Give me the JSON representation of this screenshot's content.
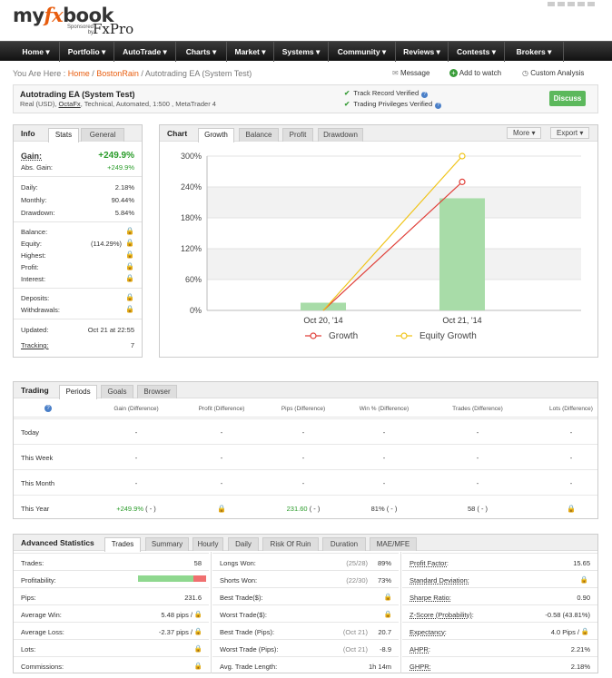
{
  "brand": {
    "logo_left": "my",
    "logo_fx": "fx",
    "logo_right": "book",
    "sponsored": "Sponsored",
    "by": "by",
    "sponsor": "FxPro"
  },
  "nav": [
    "Home ▾",
    "Portfolio ▾",
    "AutoTrade ▾",
    "Charts ▾",
    "Market ▾",
    "Systems ▾",
    "Community ▾",
    "Reviews ▾",
    "Contests ▾",
    "Brokers ▾"
  ],
  "breadcrumb": {
    "prefix": "You Are Here :",
    "home": "Home",
    "sep1": "/",
    "user": "BostonRain",
    "sep2": "/",
    "page": "Autotrading EA (System Test)"
  },
  "actions": {
    "message": "Message",
    "watch": "Add to watch",
    "custom": "Custom Analysis"
  },
  "system": {
    "title": "Autotrading EA (System Test)",
    "sub_pre": "Real (USD), ",
    "broker": "OctaFx",
    "sub_post": ", Technical, Automated, 1:500 , MetaTrader 4",
    "verified1": "Track Record Verified",
    "verified2": "Trading Privileges Verified",
    "discuss": "Discuss"
  },
  "info": {
    "title": "Info",
    "tabs": [
      "Stats",
      "General"
    ],
    "gain_label": "Gain:",
    "gain_value": "+249.9%",
    "abs_label": "Abs. Gain:",
    "abs_value": "+249.9%",
    "daily_label": "Daily:",
    "daily_value": "2.18%",
    "monthly_label": "Monthly:",
    "monthly_value": "90.44%",
    "drawdown_label": "Drawdown:",
    "drawdown_value": "5.84%",
    "balance_label": "Balance:",
    "equity_label": "Equity:",
    "equity_value": "(114.29%)",
    "highest_label": "Highest:",
    "profit_label": "Profit:",
    "interest_label": "Interest:",
    "deposits_label": "Deposits:",
    "withdrawals_label": "Withdrawals:",
    "updated_label": "Updated:",
    "updated_value": "Oct 21 at 22:55",
    "tracking_label": "Tracking:",
    "tracking_value": "7"
  },
  "chartpanel": {
    "title": "Chart",
    "tabs": [
      "Growth",
      "Balance",
      "Profit",
      "Drawdown"
    ],
    "more": "More ▾",
    "export": "Export ▾"
  },
  "chart_data": {
    "type": "line",
    "categories": [
      "Oct 20, '14",
      "Oct 21, '14"
    ],
    "series": [
      {
        "name": "Growth",
        "values": [
          0,
          249.9
        ],
        "color": "#e0403a"
      },
      {
        "name": "Equity Growth",
        "values": [
          0,
          300
        ],
        "color": "#f0c419"
      }
    ],
    "bars": [
      15,
      218
    ],
    "bar_color": "#a8dca8",
    "yticks": [
      "300%",
      "240%",
      "180%",
      "120%",
      "60%",
      "0%"
    ],
    "ylim": [
      0,
      300
    ]
  },
  "trading": {
    "title": "Trading",
    "tabs": [
      "Periods",
      "Goals",
      "Browser"
    ],
    "headers": [
      "Gain (Difference)",
      "Profit (Difference)",
      "Pips (Difference)",
      "Win % (Difference)",
      "Trades (Difference)",
      "Lots (Difference)"
    ],
    "rows": [
      {
        "label": "Today",
        "cells": [
          "-",
          "-",
          "-",
          "-",
          "-",
          "-"
        ]
      },
      {
        "label": "This Week",
        "cells": [
          "-",
          "-",
          "-",
          "-",
          "-",
          "-"
        ]
      },
      {
        "label": "This Month",
        "cells": [
          "-",
          "-",
          "-",
          "-",
          "-",
          "-"
        ]
      },
      {
        "label": "This Year",
        "cells": [
          "+249.9%",
          "",
          "231.60",
          "81%",
          "58",
          ""
        ],
        "diffs": [
          "( - )",
          "",
          "( - )",
          "( - )",
          "( - )",
          ""
        ]
      }
    ]
  },
  "advanced": {
    "title": "Advanced Statistics",
    "tabs": [
      "Trades",
      "Summary",
      "Hourly",
      "Daily",
      "Risk Of Ruin",
      "Duration",
      "MAE/MFE"
    ],
    "col1": [
      [
        "Trades:",
        "58"
      ],
      [
        "Profitability:",
        ""
      ],
      [
        "Pips:",
        "231.6"
      ],
      [
        "Average Win:",
        "5.48 pips /"
      ],
      [
        "Average Loss:",
        "-2.37 pips /"
      ],
      [
        "Lots:",
        ""
      ],
      [
        "Commissions:",
        ""
      ]
    ],
    "col2": [
      [
        "Longs Won:",
        "(25/28)",
        "89%"
      ],
      [
        "Shorts Won:",
        "(22/30)",
        "73%"
      ],
      [
        "Best Trade($):",
        "",
        ""
      ],
      [
        "Worst Trade($):",
        "",
        ""
      ],
      [
        "Best Trade (Pips):",
        "(Oct 21)",
        "20.7"
      ],
      [
        "Worst Trade (Pips):",
        "(Oct 21)",
        "-8.9"
      ],
      [
        "Avg. Trade Length:",
        "",
        "1h 14m"
      ]
    ],
    "col3": [
      [
        "Profit Factor:",
        "15.65"
      ],
      [
        "Standard Deviation:",
        ""
      ],
      [
        "Sharpe Ratio:",
        "0.90"
      ],
      [
        "Z-Score (Probability):",
        "-0.58 (43.81%)"
      ],
      [
        "Expectancy:",
        "4.0 Pips /"
      ],
      [
        "AHPR:",
        "2.21%"
      ],
      [
        "GHPR:",
        "2.18%"
      ]
    ],
    "profitability": 0.81
  }
}
